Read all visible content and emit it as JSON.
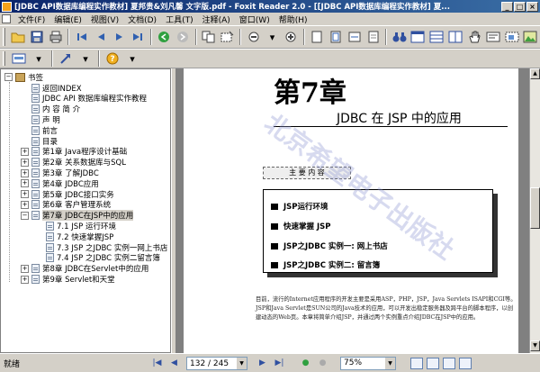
{
  "window": {
    "title": "[JDBC API数据库编程实作教材] 夏邦贵&刘凡馨 文字版.pdf - Foxit Reader 2.0 - [[JDBC API数据库编程实作教材] 夏..."
  },
  "menu": [
    "文件(F)",
    "编辑(E)",
    "视图(V)",
    "文档(D)",
    "工具(T)",
    "注释(A)",
    "窗口(W)",
    "帮助(H)"
  ],
  "bookmarks": {
    "root": "书签",
    "items": [
      {
        "label": "返回INDEX",
        "level": 1,
        "expandable": false
      },
      {
        "label": "JDBC API 数据库编程实作教程",
        "level": 1,
        "expandable": false
      },
      {
        "label": "内 容 简 介",
        "level": 1,
        "expandable": false
      },
      {
        "label": "声 明",
        "level": 1,
        "expandable": false
      },
      {
        "label": "前言",
        "level": 1,
        "expandable": false
      },
      {
        "label": "目录",
        "level": 1,
        "expandable": false
      },
      {
        "label": "第1章 Java程序设计基础",
        "level": 1,
        "expandable": true
      },
      {
        "label": "第2章 关系数据库与SQL",
        "level": 1,
        "expandable": true
      },
      {
        "label": "第3章 了解JDBC",
        "level": 1,
        "expandable": true
      },
      {
        "label": "第4章 JDBC应用",
        "level": 1,
        "expandable": true
      },
      {
        "label": "第5章 JDBC接口实务",
        "level": 1,
        "expandable": true
      },
      {
        "label": "第6章 客户管理系统",
        "level": 1,
        "expandable": true
      },
      {
        "label": "第7章 JDBC在JSP中的应用",
        "level": 1,
        "expandable": true,
        "expanded": true,
        "selected": true
      },
      {
        "label": "7.1 JSP 运行环境",
        "level": 2,
        "expandable": false
      },
      {
        "label": "7.2 快速掌握JSP",
        "level": 2,
        "expandable": false
      },
      {
        "label": "7.3 JSP 之JDBC 实例一网上书店",
        "level": 2,
        "expandable": false
      },
      {
        "label": "7.4 JSP 之JDBC 实例二留言簿",
        "level": 2,
        "expandable": false
      },
      {
        "label": "第8章 JDBC在Servlet中的应用",
        "level": 1,
        "expandable": true
      },
      {
        "label": "第9章 Servlet和天堂",
        "level": 1,
        "expandable": true
      }
    ]
  },
  "page": {
    "chapter_number": "第7章",
    "chapter_title": "JDBC 在 JSP 中的应用",
    "content_header": "主 要 内 容",
    "content_items": [
      "JSP运行环境",
      "快速掌握 JSP",
      "JSP之JDBC 实例一: 网上书店",
      "JSP之JDBC 实例二: 留言簿"
    ],
    "paragraph": "目前，流行的Internet应用程序的开发主要是采用ASP，PHP，JSP，Java Servlets ISAPI和CGI等。JSP和Java Servlet是SUN公司的Java技术的应用，可以开发出稳定服务器及跨平台的脚本程序，以创建动态的Web页。本章将简单介绍JSP，并通过两个实例重点介绍JDBC在JSP中的应用。",
    "watermark": "北京希望电子出版社"
  },
  "status": {
    "text": "就绪",
    "page_indicator": "132 / 245",
    "zoom": "75%"
  }
}
